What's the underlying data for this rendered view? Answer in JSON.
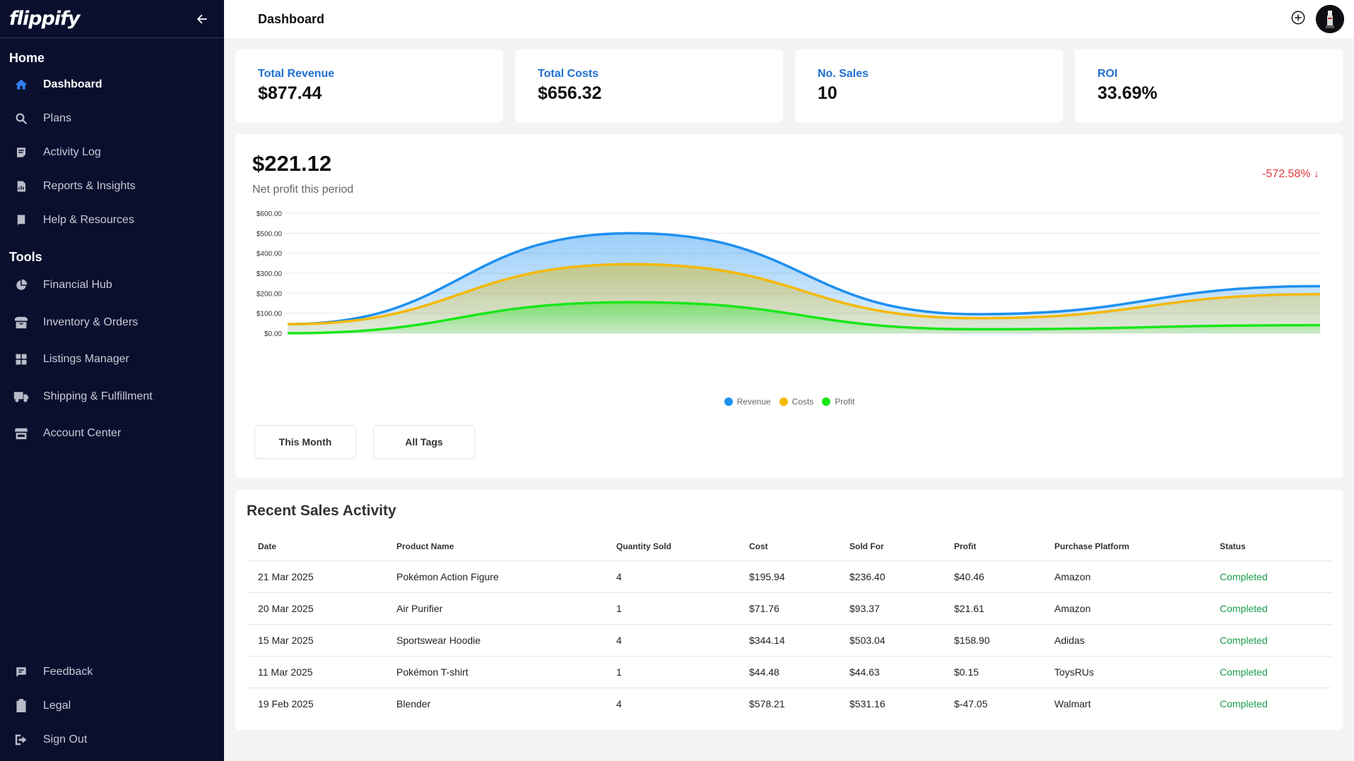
{
  "brand": {
    "name": "flippify"
  },
  "sidebar": {
    "home_title": "Home",
    "home_items": [
      {
        "label": "Dashboard",
        "icon": "home-icon",
        "active": true
      },
      {
        "label": "Plans",
        "icon": "search-icon"
      },
      {
        "label": "Activity Log",
        "icon": "log-icon"
      },
      {
        "label": "Reports & Insights",
        "icon": "report-icon"
      },
      {
        "label": "Help & Resources",
        "icon": "book-icon"
      }
    ],
    "tools_title": "Tools",
    "tools_items": [
      {
        "label": "Financial Hub",
        "icon": "pie-chart-icon"
      },
      {
        "label": "Inventory & Orders",
        "icon": "box-icon"
      },
      {
        "label": "Listings Manager",
        "icon": "grid-icon"
      },
      {
        "label": "Shipping & Fulfillment",
        "icon": "truck-icon"
      },
      {
        "label": "Account Center",
        "icon": "store-icon"
      }
    ],
    "bottom_items": [
      {
        "label": "Feedback",
        "icon": "feedback-icon"
      },
      {
        "label": "Legal",
        "icon": "clipboard-icon"
      },
      {
        "label": "Sign Out",
        "icon": "sign-out-icon"
      }
    ]
  },
  "header": {
    "title": "Dashboard"
  },
  "stats": [
    {
      "label": "Total Revenue",
      "value": "$877.44"
    },
    {
      "label": "Total Costs",
      "value": "$656.32"
    },
    {
      "label": "No. Sales",
      "value": "10"
    },
    {
      "label": "ROI",
      "value": "33.69%"
    }
  ],
  "profit": {
    "value": "$221.12",
    "label": "Net profit this period",
    "change": "-572.58% ↓"
  },
  "filters": {
    "period": "This Month",
    "tags": "All Tags"
  },
  "colors": {
    "revenue": "#1e90f0",
    "costs": "#f5b800",
    "profit": "#19e619",
    "accent": "#1f6fd1",
    "status_completed": "#1a9b4b",
    "negative": "#e0393e"
  },
  "chart_data": {
    "type": "area",
    "y_ticks": [
      "$600.00",
      "$500.00",
      "$400.00",
      "$300.00",
      "$200.00",
      "$100.00",
      "$0.00"
    ],
    "ylim": [
      0,
      600
    ],
    "grid": true,
    "legend_position": "bottom",
    "series": [
      {
        "name": "Revenue",
        "values": [
          45,
          500,
          95,
          235
        ]
      },
      {
        "name": "Costs",
        "values": [
          45,
          345,
          75,
          195
        ]
      },
      {
        "name": "Profit",
        "values": [
          0,
          155,
          20,
          40
        ]
      }
    ]
  },
  "recent_sales": {
    "title": "Recent Sales Activity",
    "columns": [
      "Date",
      "Product Name",
      "Quantity Sold",
      "Cost",
      "Sold For",
      "Profit",
      "Purchase Platform",
      "Status"
    ],
    "rows": [
      [
        "21 Mar 2025",
        "Pokémon Action Figure",
        "4",
        "$195.94",
        "$236.40",
        "$40.46",
        "Amazon",
        "Completed"
      ],
      [
        "20 Mar 2025",
        "Air Purifier",
        "1",
        "$71.76",
        "$93.37",
        "$21.61",
        "Amazon",
        "Completed"
      ],
      [
        "15 Mar 2025",
        "Sportswear Hoodie",
        "4",
        "$344.14",
        "$503.04",
        "$158.90",
        "Adidas",
        "Completed"
      ],
      [
        "11 Mar 2025",
        "Pokémon T-shirt",
        "1",
        "$44.48",
        "$44.63",
        "$0.15",
        "ToysRUs",
        "Completed"
      ],
      [
        "19 Feb 2025",
        "Blender",
        "4",
        "$578.21",
        "$531.16",
        "$-47.05",
        "Walmart",
        "Completed"
      ]
    ]
  }
}
